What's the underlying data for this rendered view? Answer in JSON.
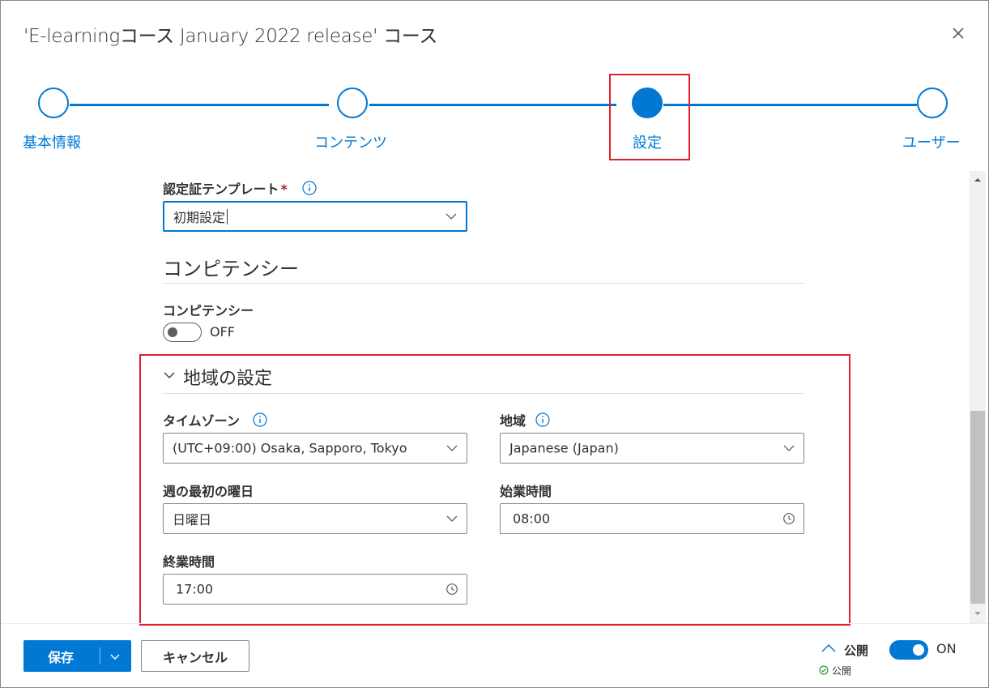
{
  "dialog": {
    "title": "'E-learningコース January 2022 release' コース"
  },
  "stepper": {
    "steps": [
      {
        "label": "基本情報",
        "state": "incomplete"
      },
      {
        "label": "コンテンツ",
        "state": "incomplete"
      },
      {
        "label": "設定",
        "state": "active"
      },
      {
        "label": "ユーザー",
        "state": "incomplete"
      }
    ]
  },
  "certificate": {
    "label": "認定証テンプレート",
    "required_mark": "*",
    "value": "初期設定"
  },
  "competency_section": {
    "title": "コンピテンシー",
    "toggle_label": "コンピテンシー",
    "toggle_state": "OFF"
  },
  "regional": {
    "title": "地域の設定",
    "timezone": {
      "label": "タイムゾーン",
      "value": "(UTC+09:00) Osaka, Sapporo, Tokyo"
    },
    "region": {
      "label": "地域",
      "value": "Japanese (Japan)"
    },
    "first_day": {
      "label": "週の最初の曜日",
      "value": "日曜日"
    },
    "start_time": {
      "label": "始業時間",
      "value": "08:00"
    },
    "end_time": {
      "label": "終業時間",
      "value": "17:00"
    }
  },
  "footer": {
    "save_label": "保存",
    "cancel_label": "キャンセル",
    "publish_label": "公開",
    "publish_toggle": "ON",
    "publish_status": "公開"
  },
  "colors": {
    "accent": "#0078d4",
    "highlight": "#e0202a"
  }
}
